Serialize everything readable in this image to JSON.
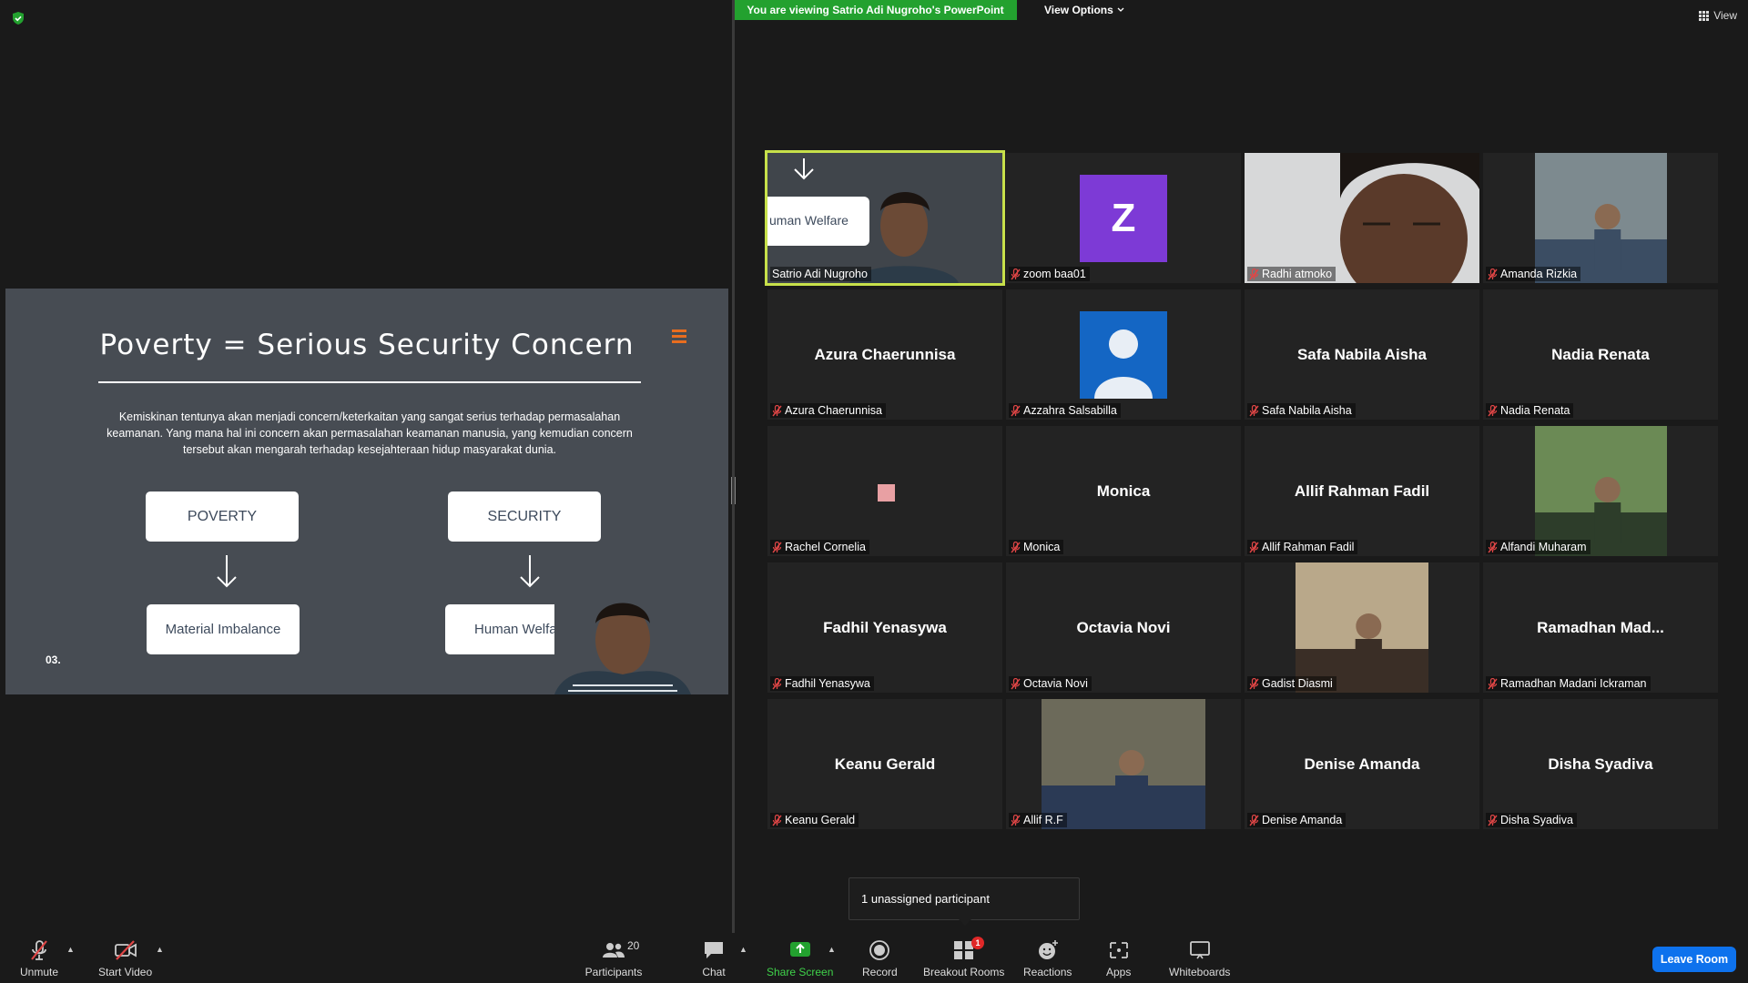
{
  "banner": {
    "text": "You are viewing Satrio Adi Nugroho's PowerPoint",
    "view_options": "View Options",
    "view": "View"
  },
  "colors": {
    "banner_green": "#23a12f",
    "active_speaker": "#c7e04a",
    "leave_blue": "#0e72ed",
    "muted_red": "#e04646"
  },
  "slide": {
    "title": "Poverty = Serious Security Concern",
    "body": "Kemiskinan tentunya akan menjadi concern/keterkaitan yang sangat serius terhadap permasalahan keamanan. Yang mana hal ini concern akan permasalahan keamanan manusia, yang kemudian concern tersebut akan mengarah terhadap kesejahteraan hidup masyarakat dunia.",
    "box_poverty": "POVERTY",
    "box_security": "SECURITY",
    "box_material": "Material Imbalance",
    "box_welfare": "Human Welfare",
    "slide_number": "03."
  },
  "participants": [
    {
      "label": "Satrio Adi Nugroho",
      "display": "",
      "kind": "video-active",
      "slide_text": "uman Welfare"
    },
    {
      "label": "zoom baa01",
      "display": "Z",
      "kind": "avatar-letter"
    },
    {
      "label": "Radhi atmoko",
      "display": "",
      "kind": "video"
    },
    {
      "label": "Amanda Rizkia",
      "display": "",
      "kind": "photo"
    },
    {
      "label": "Azura Chaerunnisa",
      "display": "Azura Chaerunnisa",
      "kind": "name"
    },
    {
      "label": "Azzahra Salsabilla",
      "display": "",
      "kind": "avatar-person"
    },
    {
      "label": "Safa Nabila Aisha",
      "display": "Safa Nabila Aisha",
      "kind": "name"
    },
    {
      "label": "Nadia Renata",
      "display": "Nadia Renata",
      "kind": "name"
    },
    {
      "label": "Rachel Cornelia",
      "display": "",
      "kind": "pink-square"
    },
    {
      "label": "Monica",
      "display": "Monica",
      "kind": "name"
    },
    {
      "label": "Allif Rahman Fadil",
      "display": "Allif Rahman Fadil",
      "kind": "name"
    },
    {
      "label": "Alfandi Muharam",
      "display": "",
      "kind": "photo"
    },
    {
      "label": "Fadhil Yenasywa",
      "display": "Fadhil Yenasywa",
      "kind": "name"
    },
    {
      "label": "Octavia Novi",
      "display": "Octavia Novi",
      "kind": "name"
    },
    {
      "label": "Gadist Diasmi",
      "display": "",
      "kind": "photo"
    },
    {
      "label": "Ramadhan Madani Ickraman",
      "display": "Ramadhan  Mad...",
      "kind": "name"
    },
    {
      "label": "Keanu Gerald",
      "display": "Keanu Gerald",
      "kind": "name"
    },
    {
      "label": "Allif R.F",
      "display": "",
      "kind": "photo"
    },
    {
      "label": "Denise Amanda",
      "display": "Denise Amanda",
      "kind": "name"
    },
    {
      "label": "Disha Syadiva",
      "display": "Disha Syadiva",
      "kind": "name"
    }
  ],
  "popup": {
    "text": "1 unassigned participant"
  },
  "toolbar": {
    "unmute": "Unmute",
    "start_video": "Start Video",
    "participants": "Participants",
    "participants_count": "20",
    "chat": "Chat",
    "share_screen": "Share Screen",
    "record": "Record",
    "breakout_rooms": "Breakout Rooms",
    "breakout_badge": "1",
    "reactions": "Reactions",
    "apps": "Apps",
    "whiteboards": "Whiteboards",
    "leave_room": "Leave Room"
  }
}
